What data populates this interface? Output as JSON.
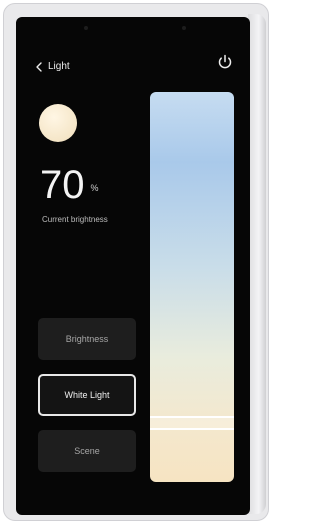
{
  "header": {
    "back_label": "Light"
  },
  "status": {
    "brightness_value": "70",
    "unit": "%",
    "caption": "Current brightness"
  },
  "modes": [
    {
      "label": "Brightness",
      "active": false
    },
    {
      "label": "White Light",
      "active": true
    },
    {
      "label": "Scene",
      "active": false
    }
  ],
  "slider": {
    "level_fraction": 0.15
  },
  "colors": {
    "screen_bg": "#060606",
    "bulb": "#f5e6c8",
    "slider_top": "#a9c9ea",
    "slider_bottom": "#f6e4c2",
    "active_border": "#e8e8e8"
  },
  "icons": {
    "back": "chevron-left-icon",
    "power": "power-icon",
    "light": "light-bulb-icon"
  }
}
